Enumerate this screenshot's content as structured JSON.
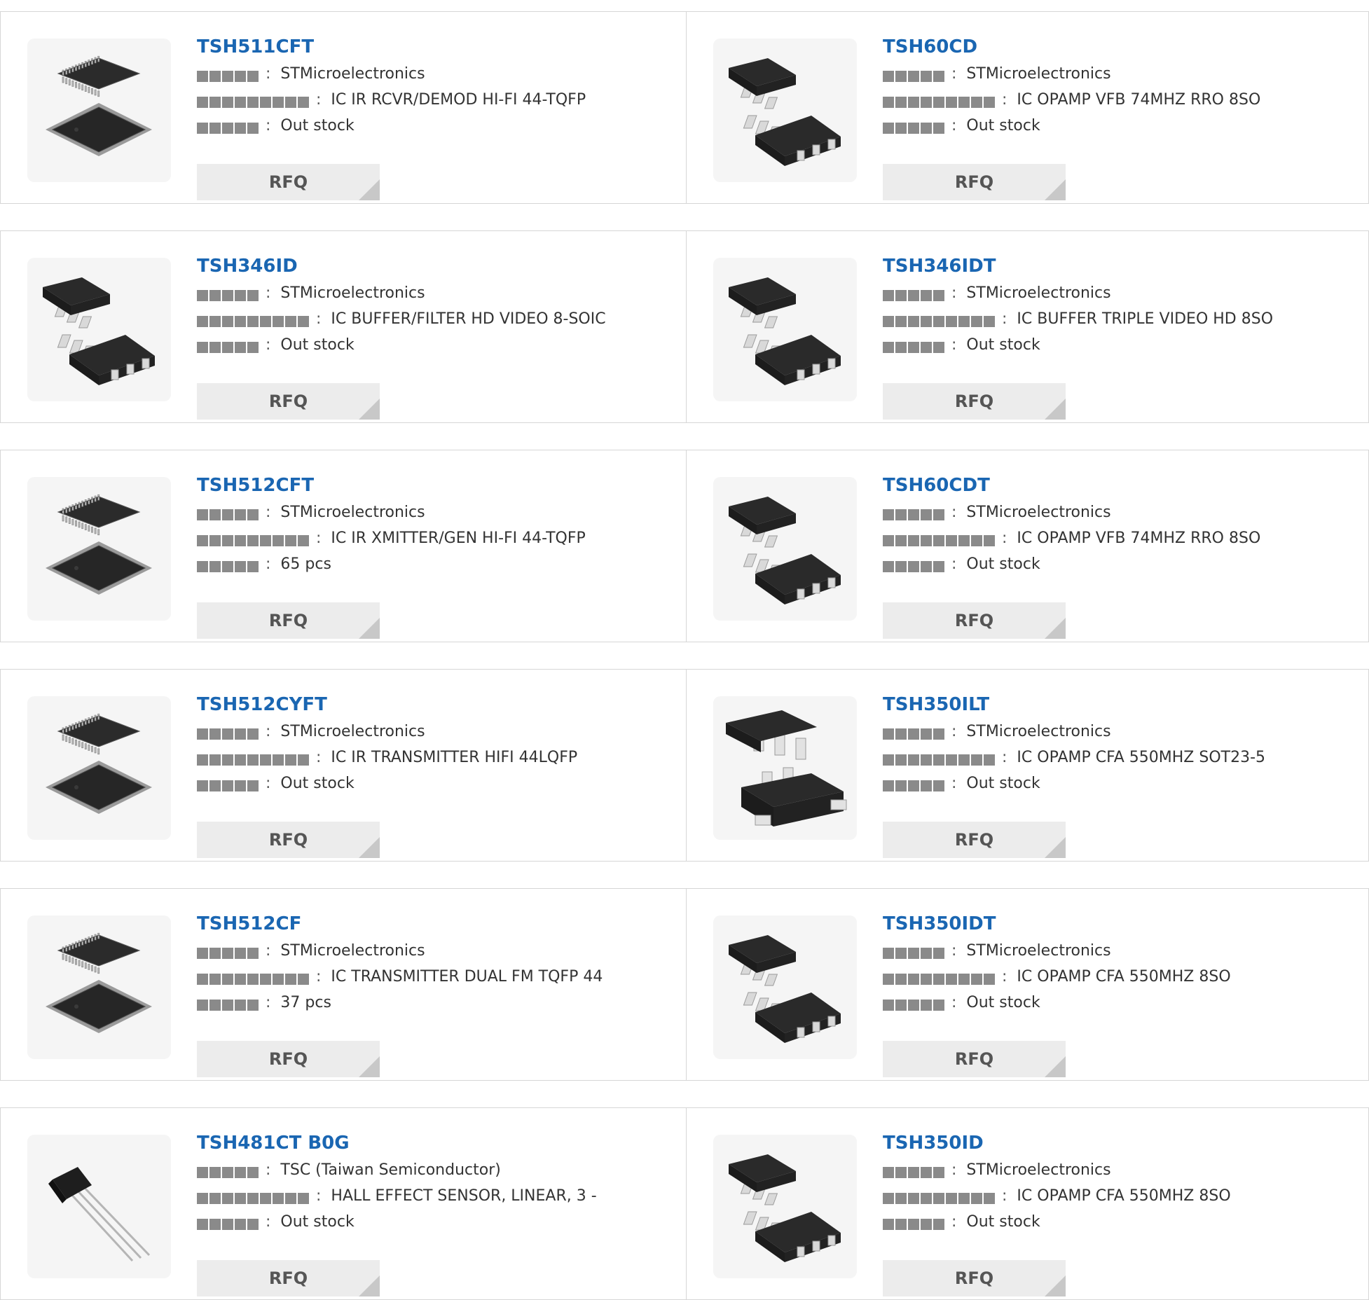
{
  "labels": {
    "manufacturer_glyphs": 5,
    "description_glyphs": 9,
    "stock_glyphs": 5,
    "separator": ":",
    "rfq": "RFQ"
  },
  "colors": {
    "part_link": "#1a66b2",
    "rfq_background": "#ececec",
    "border": "#d6d6d6"
  },
  "products": [
    {
      "part": "TSH511CFT",
      "manufacturer": "STMicroelectronics",
      "description": "IC IR RCVR/DEMOD HI-FI 44-TQFP",
      "stock": "Out stock",
      "image": "tqfp-package"
    },
    {
      "part": "TSH60CD",
      "manufacturer": "STMicroelectronics",
      "description": "IC OPAMP VFB 74MHZ RRO 8SO",
      "stock": "Out stock",
      "image": "so8-package"
    },
    {
      "part": "TSH346ID",
      "manufacturer": "STMicroelectronics",
      "description": "IC BUFFER/FILTER HD VIDEO 8-SOIC",
      "stock": "Out stock",
      "image": "so8-package"
    },
    {
      "part": "TSH346IDT",
      "manufacturer": "STMicroelectronics",
      "description": "IC BUFFER TRIPLE VIDEO HD 8SO",
      "stock": "Out stock",
      "image": "so8-package"
    },
    {
      "part": "TSH512CFT",
      "manufacturer": "STMicroelectronics",
      "description": "IC IR XMITTER/GEN HI-FI 44-TQFP",
      "stock": "65 pcs",
      "image": "tqfp-package"
    },
    {
      "part": "TSH60CDT",
      "manufacturer": "STMicroelectronics",
      "description": "IC OPAMP VFB 74MHZ RRO 8SO",
      "stock": "Out stock",
      "image": "so8-package"
    },
    {
      "part": "TSH512CYFT",
      "manufacturer": "STMicroelectronics",
      "description": "IC IR TRANSMITTER HIFI 44LQFP",
      "stock": "Out stock",
      "image": "tqfp-package"
    },
    {
      "part": "TSH350ILT",
      "manufacturer": "STMicroelectronics",
      "description": "IC OPAMP CFA 550MHZ SOT23-5",
      "stock": "Out stock",
      "image": "sot23-package"
    },
    {
      "part": "TSH512CF",
      "manufacturer": "STMicroelectronics",
      "description": "IC TRANSMITTER DUAL FM TQFP 44",
      "stock": "37 pcs",
      "image": "tqfp-package"
    },
    {
      "part": "TSH350IDT",
      "manufacturer": "STMicroelectronics",
      "description": "IC OPAMP CFA 550MHZ 8SO",
      "stock": "Out stock",
      "image": "so8-package"
    },
    {
      "part": "TSH481CT B0G",
      "manufacturer": "TSC (Taiwan Semiconductor)",
      "description": "HALL EFFECT SENSOR, LINEAR, 3 -",
      "stock": "Out stock",
      "image": "to92-package"
    },
    {
      "part": "TSH350ID",
      "manufacturer": "STMicroelectronics",
      "description": "IC OPAMP CFA 550MHZ 8SO",
      "stock": "Out stock",
      "image": "so8-package"
    }
  ]
}
